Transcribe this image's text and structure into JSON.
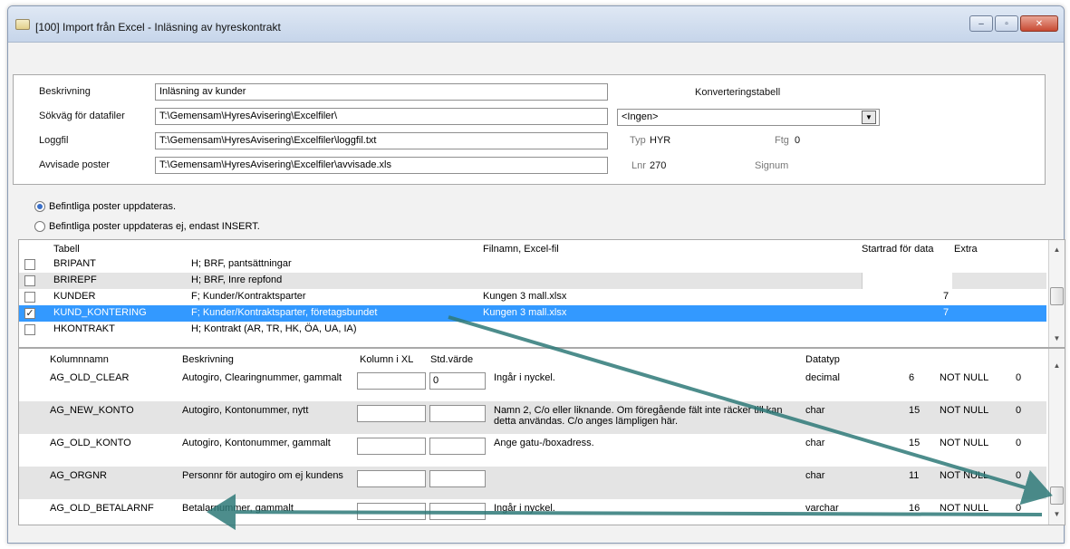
{
  "window": {
    "title": "[100] Import från Excel - Inläsning av hyreskontrakt",
    "minimize": "–",
    "maximize": "▫",
    "close": "✕"
  },
  "header": {
    "beskrivning_label": "Beskrivning",
    "beskrivning_value": "Inläsning av kunder",
    "sokvag_label": "Sökväg för datafiler",
    "sokvag_value": "T:\\Gemensam\\HyresAvisering\\Excelfiler\\",
    "loggfil_label": "Loggfil",
    "loggfil_value": "T:\\Gemensam\\HyresAvisering\\Excelfiler\\loggfil.txt",
    "avvisade_label": "Avvisade poster",
    "avvisade_value": "T:\\Gemensam\\HyresAvisering\\Excelfiler\\avvisade.xls",
    "konverteringstabell_label": "Konverteringstabell",
    "konvertering_value": "<Ingen>",
    "typ_label": "Typ",
    "typ_value": "HYR",
    "ftg_label": "Ftg",
    "ftg_value": "0",
    "lnr_label": "Lnr",
    "lnr_value": "270",
    "signum_label": "Signum"
  },
  "options": {
    "update": "Befintliga poster uppdateras.",
    "insert_only": "Befintliga poster uppdateras ej, endast INSERT."
  },
  "tables": {
    "headers": {
      "tabell": "Tabell",
      "filnamn": "Filnamn, Excel-fil",
      "startrad": "Startrad för data",
      "extra": "Extra"
    },
    "rows": [
      {
        "name": "BRIPANT",
        "desc": "H; BRF, pantsättningar",
        "file": "",
        "start": "",
        "checked": ""
      },
      {
        "name": "BRIREPF",
        "desc": "H; BRF, Inre repfond",
        "file": "",
        "start": "",
        "checked": ""
      },
      {
        "name": "KUNDER",
        "desc": "F; Kunder/Kontraktsparter",
        "file": "Kungen 3 mall.xlsx",
        "start": "7",
        "checked": ""
      },
      {
        "name": "KUND_KONTERING",
        "desc": "F; Kunder/Kontraktsparter, företagsbundet",
        "file": "Kungen 3 mall.xlsx",
        "start": "7",
        "checked": "✓"
      },
      {
        "name": "HKONTRAKT",
        "desc": "H; Kontrakt (AR, TR, HK, ÖA, UA, IA)",
        "file": "",
        "start": "",
        "checked": ""
      }
    ]
  },
  "columns": {
    "headers": {
      "kolumnnamn": "Kolumnnamn",
      "beskrivning": "Beskrivning",
      "kolumn_ixl": "Kolumn i XL",
      "std_varde": "Std.värde",
      "datatyp": "Datatyp"
    },
    "rows": [
      {
        "name": "AG_OLD_CLEAR",
        "desc": "Autogiro, Clearingnummer, gammalt",
        "xl": "",
        "std": "0",
        "info": "Ingår i nyckel.",
        "type": "decimal",
        "len": "6",
        "null": "NOT NULL",
        "extra": "0"
      },
      {
        "name": "AG_NEW_KONTO",
        "desc": "Autogiro, Kontonummer, nytt",
        "xl": "",
        "std": "",
        "info": "Namn 2, C/o eller liknande. Om föregående fält inte räcker till kan detta användas. C/o anges lämpligen här.",
        "type": "char",
        "len": "15",
        "null": "NOT NULL",
        "extra": "0"
      },
      {
        "name": "AG_OLD_KONTO",
        "desc": "Autogiro, Kontonummer, gammalt",
        "xl": "",
        "std": "",
        "info": "Ange gatu-/boxadress.",
        "type": "char",
        "len": "15",
        "null": "NOT NULL",
        "extra": "0"
      },
      {
        "name": "AG_ORGNR",
        "desc": "Personnr för autogiro om ej kundens",
        "xl": "",
        "std": "",
        "info": "",
        "type": "char",
        "len": "11",
        "null": "NOT NULL",
        "extra": "0"
      },
      {
        "name": "AG_OLD_BETALARNF",
        "desc": "Betalarnummer, gammalt",
        "xl": "",
        "std": "",
        "info": "Ingår i nyckel.",
        "type": "varchar",
        "len": "16",
        "null": "NOT NULL",
        "extra": "0"
      }
    ]
  },
  "colors": {
    "selection": "#3399ff",
    "arrow": "#2f7a78",
    "row_alt": "#e4e4e4"
  },
  "icons": {
    "app": "window-app-icon",
    "scroll_up": "chevron-up-icon",
    "scroll_down": "chevron-down-icon",
    "combo": "chevron-down-icon"
  }
}
